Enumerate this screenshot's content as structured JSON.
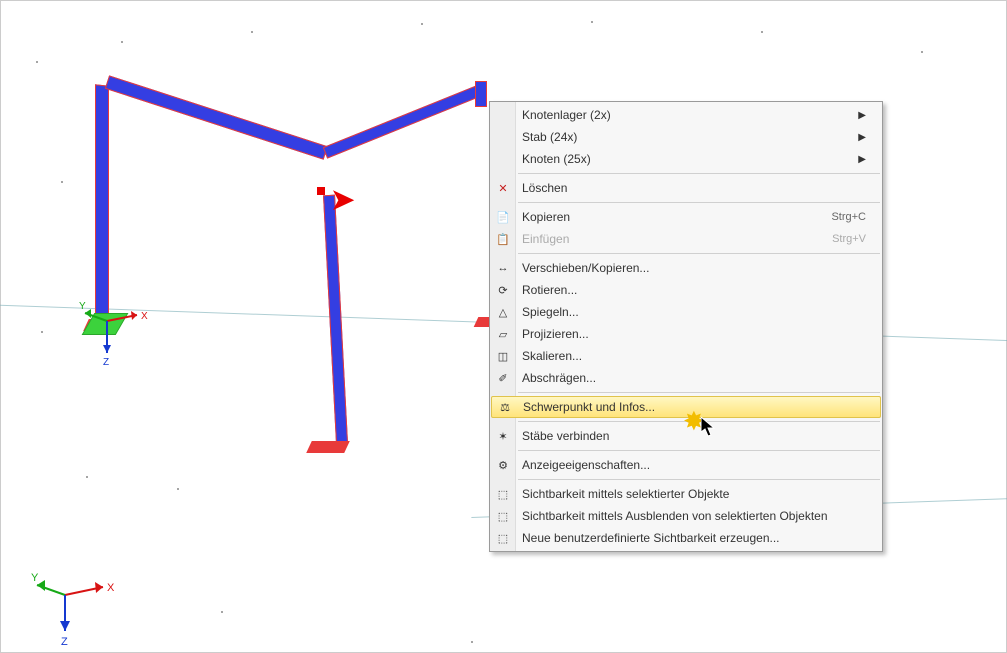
{
  "context_menu": {
    "items": [
      {
        "id": "nodal-supports",
        "label": "Knotenlager (2x)",
        "submenu": true,
        "icon": ""
      },
      {
        "id": "members",
        "label": "Stab (24x)",
        "submenu": true,
        "icon": ""
      },
      {
        "id": "nodes",
        "label": "Knoten (25x)",
        "submenu": true,
        "icon": ""
      },
      {
        "sep": true
      },
      {
        "id": "delete",
        "label": "Löschen",
        "icon": "✕",
        "icon_color": "#c62020"
      },
      {
        "sep": true
      },
      {
        "id": "copy",
        "label": "Kopieren",
        "shortcut": "Strg+C",
        "icon": "📄"
      },
      {
        "id": "paste",
        "label": "Einfügen",
        "shortcut": "Strg+V",
        "icon": "📋",
        "disabled": true
      },
      {
        "sep": true
      },
      {
        "id": "move-copy",
        "label": "Verschieben/Kopieren...",
        "icon": "↔"
      },
      {
        "id": "rotate",
        "label": "Rotieren...",
        "icon": "⟳"
      },
      {
        "id": "mirror",
        "label": "Spiegeln...",
        "icon": "△"
      },
      {
        "id": "project",
        "label": "Projizieren...",
        "icon": "▱"
      },
      {
        "id": "scale",
        "label": "Skalieren...",
        "icon": "◫"
      },
      {
        "id": "bevel",
        "label": "Abschrägen...",
        "icon": "✐"
      },
      {
        "sep": true
      },
      {
        "id": "centroid-info",
        "label": "Schwerpunkt und Infos...",
        "icon": "⚖",
        "highlight": true
      },
      {
        "sep": true
      },
      {
        "id": "connect-members",
        "label": "Stäbe verbinden",
        "icon": "✶"
      },
      {
        "sep": true
      },
      {
        "id": "display-props",
        "label": "Anzeigeeigenschaften...",
        "icon": "⚙"
      },
      {
        "sep": true
      },
      {
        "id": "vis-by-selected",
        "label": "Sichtbarkeit mittels selektierter Objekte",
        "icon": "⬚"
      },
      {
        "id": "vis-hide-selected",
        "label": "Sichtbarkeit mittels Ausblenden von selektierten Objekten",
        "icon": "⬚"
      },
      {
        "id": "new-user-vis",
        "label": "Neue benutzerdefinierte Sichtbarkeit erzeugen...",
        "icon": "⬚"
      }
    ]
  },
  "axes": {
    "x": "X",
    "y": "Y",
    "z": "Z"
  }
}
